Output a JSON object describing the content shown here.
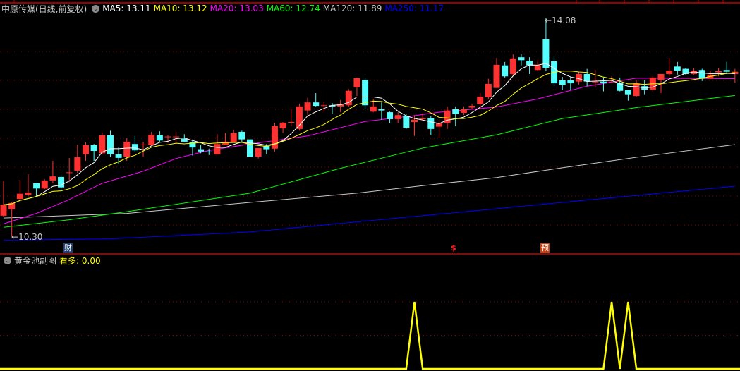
{
  "header": {
    "stock_name": "中原传媒(日线,前复权)",
    "ma_labels": [
      {
        "label": "MA5: 13.11",
        "color": "#ffffff"
      },
      {
        "label": "MA10: 13.12",
        "color": "#ffff00"
      },
      {
        "label": "MA20: 13.03",
        "color": "#ff00ff"
      },
      {
        "label": "MA60: 12.74",
        "color": "#00ff00"
      },
      {
        "label": "MA120: 11.89",
        "color": "#c8c8c8"
      },
      {
        "label": "MA250: 11.17",
        "color": "#0000ff"
      }
    ]
  },
  "annotations": {
    "high_label": "14.08",
    "low_label": "10.30",
    "arrow": "←"
  },
  "markers": {
    "finance": "财",
    "dollar": "$",
    "forecast": "预"
  },
  "sub_panel": {
    "title": "黄金池副图",
    "indicator_label": "看多: 0.00"
  },
  "colors": {
    "up": "#ff3232",
    "down": "#54ffff",
    "grid": "#8b0000",
    "separator": "#c80000",
    "indicator": "#ffff00"
  },
  "chart_data": {
    "type": "candlestick",
    "ylim": [
      10.2,
      14.2
    ],
    "grid_values": [
      10.5,
      11.0,
      11.5,
      12.0,
      12.5,
      13.0,
      13.5
    ],
    "candles_ohlc": [
      [
        10.66,
        11.26,
        10.64,
        10.85
      ],
      [
        10.77,
        10.9,
        10.3,
        10.88
      ],
      [
        10.95,
        11.28,
        10.93,
        11.04
      ],
      [
        11.02,
        11.38,
        11.0,
        11.06
      ],
      [
        11.22,
        11.23,
        10.98,
        11.13
      ],
      [
        11.13,
        11.29,
        11.12,
        11.27
      ],
      [
        11.27,
        11.61,
        11.22,
        11.34
      ],
      [
        11.33,
        11.37,
        11.1,
        11.15
      ],
      [
        11.4,
        11.66,
        11.24,
        11.41
      ],
      [
        11.44,
        11.89,
        11.4,
        11.67
      ],
      [
        11.72,
        11.93,
        11.61,
        11.88
      ],
      [
        11.88,
        11.9,
        11.61,
        11.78
      ],
      [
        11.74,
        12.1,
        11.72,
        12.05
      ],
      [
        12.05,
        12.13,
        11.68,
        11.72
      ],
      [
        11.72,
        11.84,
        11.55,
        11.66
      ],
      [
        11.68,
        12.0,
        11.61,
        11.94
      ],
      [
        11.9,
        12.04,
        11.77,
        11.79
      ],
      [
        11.88,
        11.94,
        11.68,
        11.89
      ],
      [
        11.88,
        12.11,
        11.87,
        12.06
      ],
      [
        12.05,
        12.12,
        11.94,
        11.96
      ],
      [
        12.02,
        12.05,
        11.92,
        12.03
      ],
      [
        12.02,
        12.11,
        11.92,
        12.03
      ],
      [
        11.99,
        12.07,
        11.93,
        11.94
      ],
      [
        11.93,
        11.98,
        11.7,
        11.84
      ],
      [
        11.81,
        11.89,
        11.74,
        11.77
      ],
      [
        11.77,
        11.82,
        11.71,
        11.76
      ],
      [
        11.72,
        12.07,
        11.72,
        11.9
      ],
      [
        11.88,
        12.09,
        11.88,
        11.94
      ],
      [
        11.93,
        12.15,
        11.93,
        12.09
      ],
      [
        12.11,
        12.13,
        11.92,
        11.98
      ],
      [
        11.98,
        12.0,
        11.68,
        11.68
      ],
      [
        11.68,
        11.83,
        11.65,
        11.83
      ],
      [
        11.87,
        11.9,
        11.72,
        11.81
      ],
      [
        11.82,
        12.27,
        11.77,
        12.21
      ],
      [
        12.17,
        12.28,
        12.09,
        12.27
      ],
      [
        12.27,
        12.5,
        12.21,
        12.28
      ],
      [
        12.16,
        12.6,
        12.13,
        12.55
      ],
      [
        12.48,
        12.7,
        12.4,
        12.62
      ],
      [
        12.62,
        12.78,
        12.55,
        12.56
      ],
      [
        12.56,
        12.63,
        12.46,
        12.57
      ],
      [
        12.57,
        12.61,
        12.42,
        12.55
      ],
      [
        12.55,
        12.66,
        12.45,
        12.59
      ],
      [
        12.57,
        12.85,
        12.54,
        12.82
      ],
      [
        12.88,
        13.05,
        12.73,
        13.04
      ],
      [
        13.01,
        13.04,
        12.5,
        12.57
      ],
      [
        12.46,
        12.68,
        12.45,
        12.55
      ],
      [
        12.5,
        12.62,
        12.32,
        12.48
      ],
      [
        12.45,
        12.46,
        12.26,
        12.33
      ],
      [
        12.33,
        12.45,
        12.26,
        12.4
      ],
      [
        12.39,
        12.42,
        12.16,
        12.18
      ],
      [
        12.28,
        12.4,
        12.04,
        12.32
      ],
      [
        12.33,
        12.43,
        12.31,
        12.35
      ],
      [
        12.35,
        12.38,
        12.06,
        12.16
      ],
      [
        12.2,
        12.31,
        12.0,
        12.26
      ],
      [
        12.26,
        12.55,
        12.16,
        12.48
      ],
      [
        12.5,
        12.55,
        12.21,
        12.42
      ],
      [
        12.44,
        12.55,
        12.4,
        12.5
      ],
      [
        12.53,
        12.59,
        12.5,
        12.56
      ],
      [
        12.59,
        12.78,
        12.5,
        12.72
      ],
      [
        12.71,
        13.03,
        12.67,
        12.94
      ],
      [
        12.87,
        13.39,
        12.87,
        13.27
      ],
      [
        13.26,
        13.32,
        13.05,
        13.07
      ],
      [
        13.11,
        13.45,
        13.07,
        13.38
      ],
      [
        13.4,
        13.45,
        13.26,
        13.35
      ],
      [
        13.34,
        13.4,
        13.11,
        13.26
      ],
      [
        13.18,
        13.35,
        13.16,
        13.26
      ],
      [
        13.71,
        14.08,
        13.16,
        13.22
      ],
      [
        13.33,
        13.42,
        12.9,
        12.95
      ],
      [
        13.0,
        13.06,
        12.83,
        12.92
      ],
      [
        13.0,
        13.06,
        12.83,
        12.95
      ],
      [
        12.98,
        13.14,
        12.93,
        13.11
      ],
      [
        13.11,
        13.2,
        12.9,
        12.98
      ],
      [
        12.97,
        13.18,
        12.89,
        12.98
      ],
      [
        12.98,
        13.05,
        12.81,
        12.95
      ],
      [
        12.97,
        13.07,
        12.97,
        12.98
      ],
      [
        12.96,
        13.05,
        12.81,
        12.82
      ],
      [
        12.83,
        12.83,
        12.65,
        12.76
      ],
      [
        12.73,
        13.0,
        12.72,
        12.95
      ],
      [
        12.9,
        13.0,
        12.76,
        12.84
      ],
      [
        12.84,
        13.07,
        12.81,
        13.05
      ],
      [
        13.01,
        13.11,
        12.78,
        13.11
      ],
      [
        13.11,
        13.39,
        13.07,
        13.17
      ],
      [
        13.24,
        13.32,
        13.1,
        13.17
      ],
      [
        13.2,
        13.21,
        13.1,
        13.11
      ],
      [
        13.11,
        13.22,
        13.1,
        13.17
      ],
      [
        13.18,
        13.2,
        12.99,
        13.03
      ],
      [
        13.03,
        13.17,
        13.03,
        13.1
      ],
      [
        13.14,
        13.22,
        13.07,
        13.16
      ],
      [
        13.18,
        13.32,
        13.11,
        13.15
      ],
      [
        13.11,
        13.2,
        12.96,
        13.15
      ]
    ],
    "ma_computed": [
      {
        "name": "MA5",
        "period": 5,
        "color": "#ffffff"
      },
      {
        "name": "MA10",
        "period": 10,
        "color": "#ffff00"
      }
    ],
    "ma_sampled": [
      {
        "name": "MA20",
        "color": "#ff00ff",
        "points": [
          [
            0,
            10.52
          ],
          [
            4,
            10.7
          ],
          [
            8,
            10.94
          ],
          [
            12,
            11.22
          ],
          [
            17,
            11.43
          ],
          [
            21,
            11.65
          ],
          [
            25,
            11.79
          ],
          [
            30,
            11.9
          ],
          [
            37,
            12.04
          ],
          [
            44,
            12.29
          ],
          [
            50,
            12.39
          ],
          [
            53,
            12.45
          ],
          [
            60,
            12.54
          ],
          [
            65,
            12.68
          ],
          [
            71,
            12.9
          ],
          [
            77,
            13.04
          ],
          [
            89,
            13.03
          ]
        ]
      },
      {
        "name": "MA60",
        "color": "#00ff00",
        "points": [
          [
            0,
            10.46
          ],
          [
            8,
            10.59
          ],
          [
            15,
            10.73
          ],
          [
            30,
            11.05
          ],
          [
            41,
            11.48
          ],
          [
            51,
            11.83
          ],
          [
            60,
            12.06
          ],
          [
            68,
            12.34
          ],
          [
            77,
            12.53
          ],
          [
            89,
            12.74
          ]
        ]
      },
      {
        "name": "MA120",
        "color": "#c8c8c8",
        "points": [
          [
            0,
            10.62
          ],
          [
            15,
            10.7
          ],
          [
            30,
            10.89
          ],
          [
            43,
            11.05
          ],
          [
            51,
            11.18
          ],
          [
            60,
            11.32
          ],
          [
            68,
            11.49
          ],
          [
            77,
            11.67
          ],
          [
            89,
            11.89
          ]
        ]
      },
      {
        "name": "MA250",
        "color": "#0000ff",
        "points": [
          [
            0,
            10.24
          ],
          [
            13,
            10.26
          ],
          [
            30,
            10.38
          ],
          [
            51,
            10.66
          ],
          [
            68,
            10.89
          ],
          [
            89,
            11.17
          ]
        ]
      }
    ],
    "indicator": {
      "name": "看多",
      "ylim": [
        0,
        1
      ],
      "grid_values": [
        0.5,
        1
      ],
      "signal_indices": [
        50,
        74,
        76
      ]
    }
  }
}
